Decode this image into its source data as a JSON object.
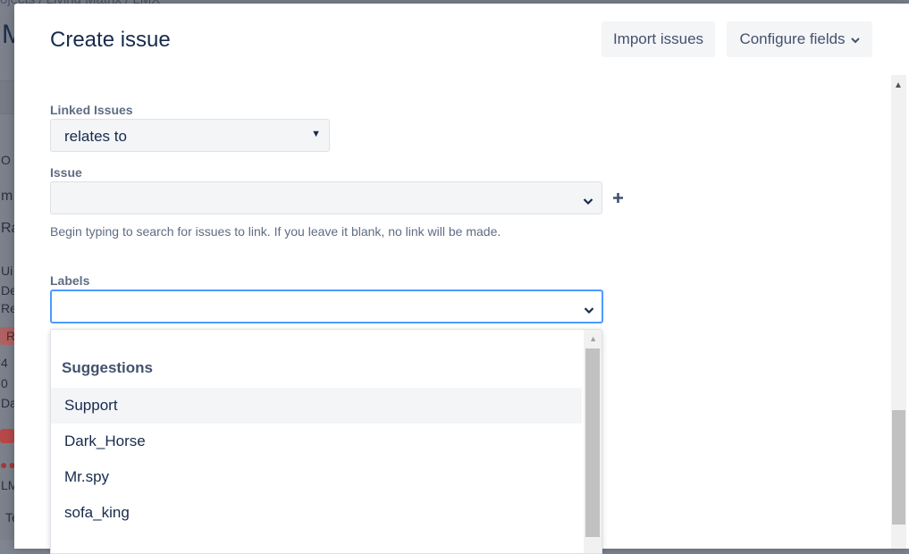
{
  "background": {
    "breadcrumb": "ojects  /  Living Matrix  /  LMX",
    "title": "M",
    "fragments": [
      "O I",
      "m",
      "Ra",
      "Ui",
      "De",
      "Re",
      "R",
      "4",
      "0",
      "Da",
      "LM",
      "Te"
    ]
  },
  "modal": {
    "title": "Create issue",
    "import_label": "Import issues",
    "configure_label": "Configure fields",
    "linked_issues": {
      "label": "Linked Issues",
      "value": "relates to"
    },
    "issue": {
      "label": "Issue",
      "value": "",
      "help": "Begin typing to search for issues to link. If you leave it blank, no link will be made."
    },
    "labels": {
      "label": "Labels",
      "value": ""
    },
    "suggestions": {
      "heading": "Suggestions",
      "items": [
        "Support",
        "Dark_Horse",
        "Mr.spy",
        "sofa_king"
      ]
    }
  },
  "colors": {
    "accent": "#4c9aff",
    "title": "#172b4d",
    "subtle": "#5e6c84",
    "field_bg": "#f4f5f7"
  }
}
